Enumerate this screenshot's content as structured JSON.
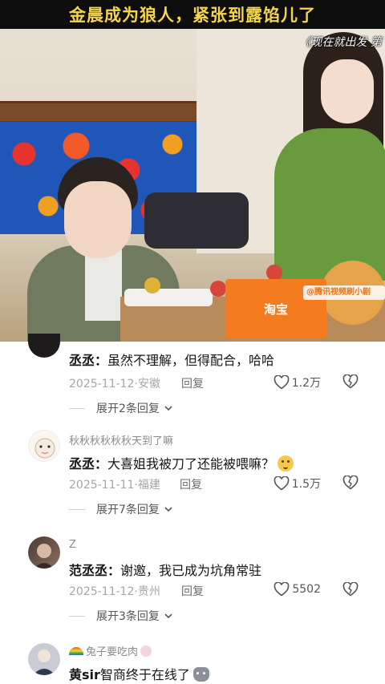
{
  "video": {
    "banner_title": "金晨成为狼人，紧张到露馅儿了",
    "watermark": "《现在就出发 第",
    "taobao_label": "淘宝",
    "overlay_tag": "@腾讯视频刷小剧"
  },
  "comments": [
    {
      "username": "",
      "author": "丞丞",
      "separator": "：",
      "content": "虽然不理解，但得配合，哈哈",
      "date": "2025-11-12",
      "dot": "·",
      "location": "安徽",
      "reply_label": "回复",
      "likes": "1.2万",
      "expand_label": "展开2条回复",
      "emoji": ""
    },
    {
      "username": "秋秋秋秋秋秋天到了嘛",
      "author": "丞丞",
      "separator": "：",
      "content": "大喜姐我被刀了还能被喂嘛？",
      "date": "2025-11-11",
      "dot": "·",
      "location": "福建",
      "reply_label": "回复",
      "likes": "1.5万",
      "expand_label": "展开7条回复",
      "emoji": "thinking-face-emoji"
    },
    {
      "username": "Z",
      "author": "范丞丞",
      "separator": "：",
      "content": "谢邀，我已成为坑角常驻",
      "date": "2025-11-12",
      "dot": "·",
      "location": "贵州",
      "reply_label": "回复",
      "likes": "5502",
      "expand_label": "展开3条回复",
      "emoji": ""
    },
    {
      "username": "兔子要吃肉",
      "author": "黄sir",
      "separator": "",
      "content": "智商终于在线了",
      "emoji": "cat-emoji"
    }
  ],
  "colors": {
    "banner_bg": "#0e0e0e",
    "banner_text": "#f6d54b",
    "meta_text": "#a6a6ab",
    "body_text": "#16161a",
    "taobao_orange": "#f57b1f"
  },
  "icons": {
    "like": "heart-outline-icon",
    "dislike": "broken-heart-icon",
    "expand": "chevron-down-icon"
  }
}
